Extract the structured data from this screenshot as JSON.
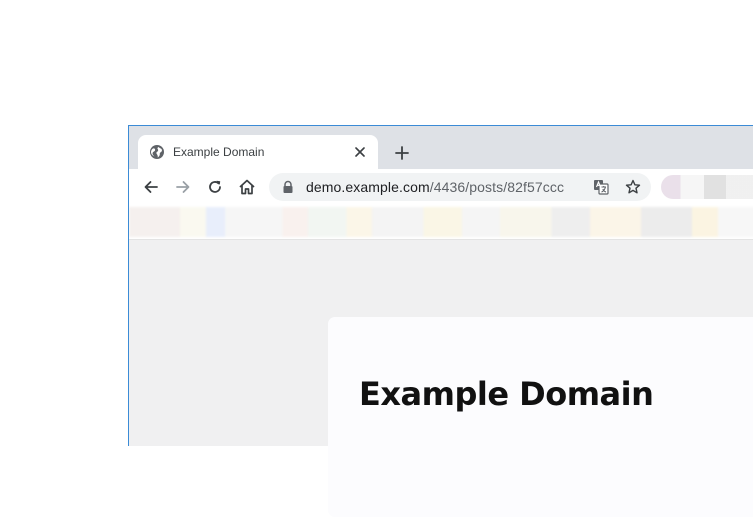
{
  "tab": {
    "title": "Example Domain"
  },
  "toolbar": {
    "url_host": "demo.example.com",
    "url_path": "/4436/posts/82f57ccc"
  },
  "page": {
    "heading": "Example Domain"
  },
  "colors": {
    "window_border": "#3b8bd6",
    "tabstrip": "#dee1e6",
    "omnibox": "#f1f3f4",
    "content_bg": "#f0f0f1"
  },
  "icons": [
    "globe-icon",
    "close-icon",
    "plus-icon",
    "back-arrow-icon",
    "forward-arrow-icon",
    "reload-icon",
    "home-icon",
    "lock-icon",
    "translate-icon",
    "star-icon"
  ]
}
